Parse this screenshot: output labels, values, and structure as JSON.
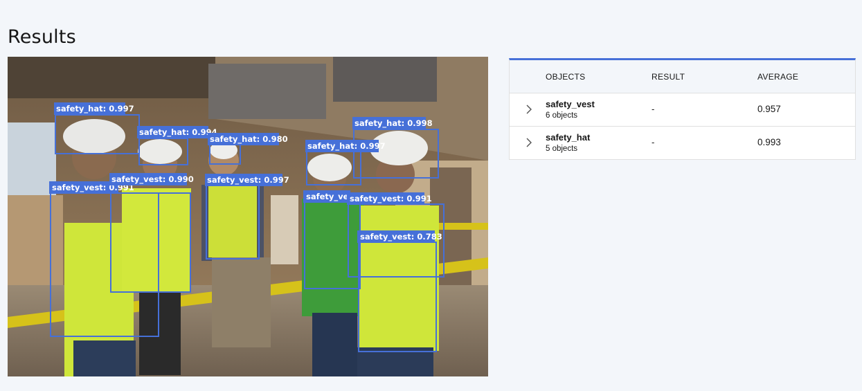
{
  "page": {
    "title": "Results"
  },
  "detections": [
    {
      "label": "safety_hat: 0.997"
    },
    {
      "label": "safety_hat: 0.994"
    },
    {
      "label": "safety_hat: 0.980"
    },
    {
      "label": "safety_hat: 0.997"
    },
    {
      "label": "safety_hat: 0.998"
    },
    {
      "label": "safety_vest: 0.991"
    },
    {
      "label": "safety_vest: 0.990"
    },
    {
      "label": "safety_vest: 0.997"
    },
    {
      "label": "safety_vest"
    },
    {
      "label": "safety_vest: 0.991"
    },
    {
      "label": "safety_vest: 0.783"
    }
  ],
  "table": {
    "headers": {
      "objects": "OBJECTS",
      "result": "RESULT",
      "average": "AVERAGE"
    },
    "rows": [
      {
        "name": "safety_vest",
        "count": "6 objects",
        "result": "-",
        "average": "0.957"
      },
      {
        "name": "safety_hat",
        "count": "5 objects",
        "result": "-",
        "average": "0.993"
      }
    ]
  },
  "colors": {
    "accent": "#4670d8",
    "bbox": "#4670d8"
  }
}
